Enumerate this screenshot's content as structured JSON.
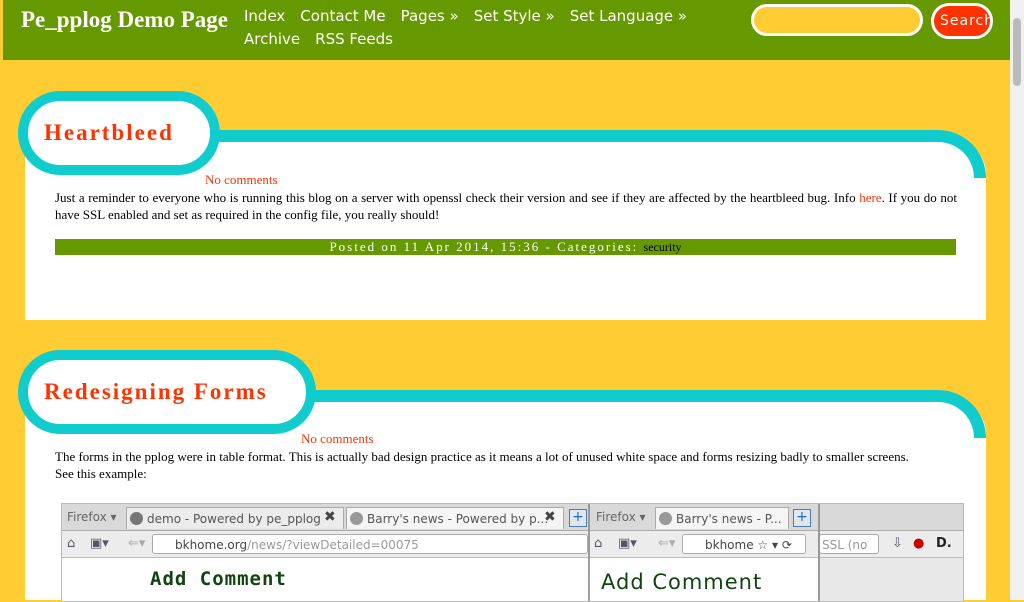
{
  "site": {
    "title": "Pe_pplog Demo Page"
  },
  "nav": {
    "items": [
      "Index",
      "Contact Me",
      "Pages »",
      "Set Style »",
      "Set Language »",
      "Archive",
      "RSS Feeds"
    ]
  },
  "search": {
    "button_label": "Search",
    "placeholder": ""
  },
  "posts": [
    {
      "title": "Heartbleed",
      "comments": "No comments",
      "text_before_link": "Just a reminder to everyone who is running this blog on a server with openssl check their version and see if they are affected by the heartbleed bug. Info ",
      "link_text": "here",
      "text_after_link": ". If you do not have SSL enabled and set as required in the config file, you really should!",
      "meta": "Posted on 11 Apr 2014, 15:36 - Categories:",
      "category": "security"
    },
    {
      "title": "Redesigning Forms",
      "comments": "No comments",
      "text": "The forms in the pplog were in table format. This is actually bad design practice as it means a lot of unused white space and forms resizing badly to smaller screens.",
      "text2": "See this example:"
    }
  ],
  "screenshot": {
    "firefox_label": "Firefox ▾",
    "tab1": "demo - Powered by pe_pplog",
    "tab2": "Barry's news - Powered by p...",
    "tab3": "Barry's news - P...",
    "url_host": "bkhome.org",
    "url_path": "/news/?viewDetailed=00075",
    "url2": "bkhome",
    "ssl_text": "SSL (no",
    "heading1": "Add Comment",
    "heading2": "Add Comment"
  }
}
